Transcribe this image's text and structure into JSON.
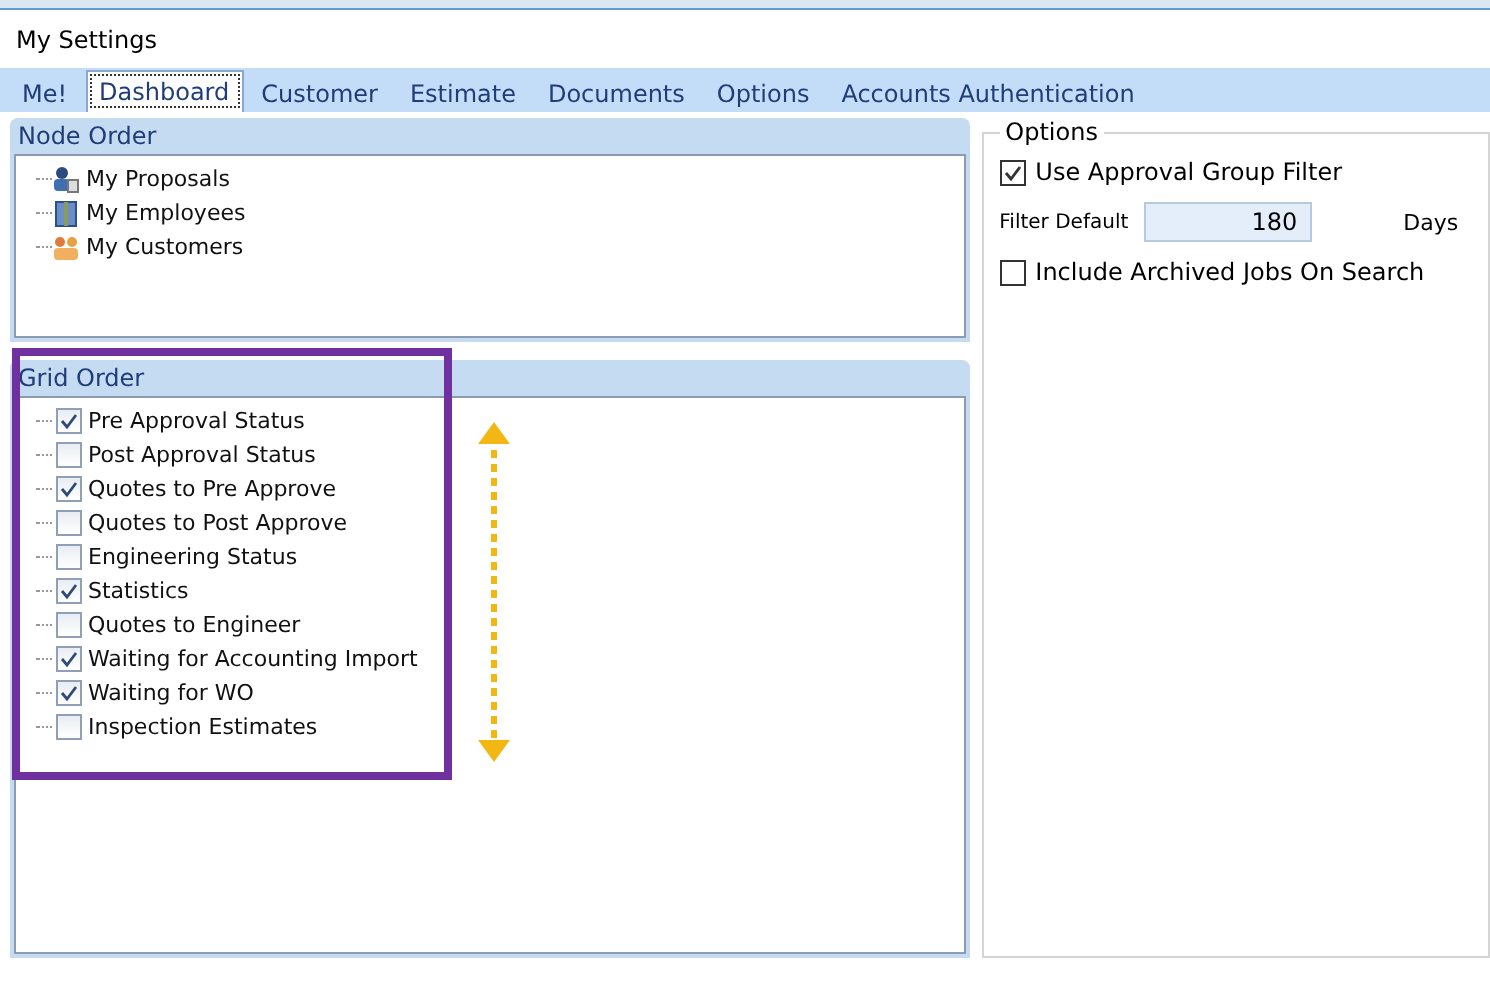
{
  "window": {
    "title": "My Settings"
  },
  "tabs": [
    {
      "label": "Me!",
      "selected": false
    },
    {
      "label": "Dashboard",
      "selected": true
    },
    {
      "label": "Customer",
      "selected": false
    },
    {
      "label": "Estimate",
      "selected": false
    },
    {
      "label": "Documents",
      "selected": false
    },
    {
      "label": "Options",
      "selected": false
    },
    {
      "label": "Accounts Authentication",
      "selected": false
    }
  ],
  "node_order": {
    "title": "Node Order",
    "items": [
      {
        "label": "My Proposals",
        "kind": "proposals"
      },
      {
        "label": "My Employees",
        "kind": "employees"
      },
      {
        "label": "My Customers",
        "kind": "customers"
      }
    ]
  },
  "grid_order": {
    "title": "Grid Order",
    "items": [
      {
        "label": "Pre Approval Status",
        "checked": true
      },
      {
        "label": "Post Approval Status",
        "checked": false
      },
      {
        "label": "Quotes to Pre Approve",
        "checked": true
      },
      {
        "label": "Quotes to Post Approve",
        "checked": false
      },
      {
        "label": "Engineering Status",
        "checked": false
      },
      {
        "label": "Statistics",
        "checked": true
      },
      {
        "label": "Quotes to Engineer",
        "checked": false
      },
      {
        "label": "Waiting for Accounting Import",
        "checked": true
      },
      {
        "label": "Waiting for WO",
        "checked": true
      },
      {
        "label": "Inspection Estimates",
        "checked": false
      }
    ]
  },
  "options": {
    "title": "Options",
    "use_approval_group_filter": {
      "label": "Use Approval Group Filter",
      "checked": true
    },
    "filter_default": {
      "label": "Filter Default",
      "value": "180",
      "unit": "Days"
    },
    "include_archived": {
      "label": "Include Archived Jobs On Search",
      "checked": false
    }
  }
}
